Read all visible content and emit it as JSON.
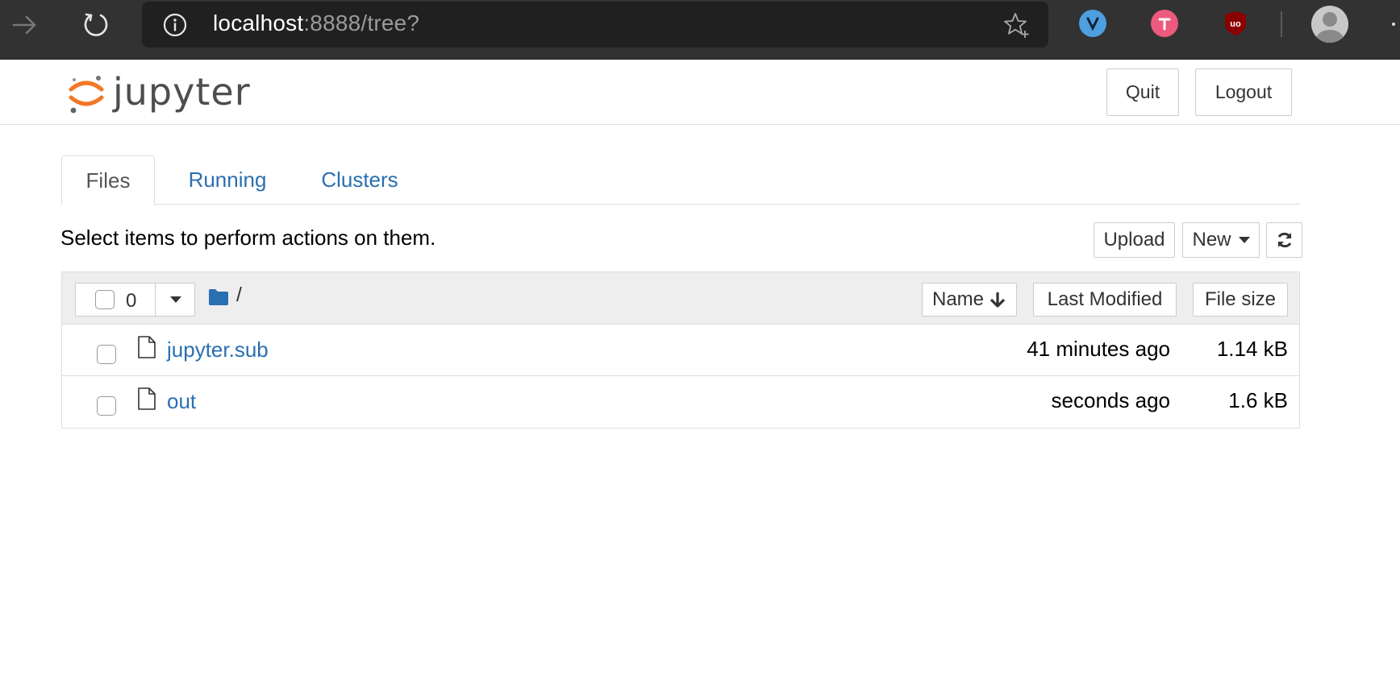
{
  "browser": {
    "url_host": "localhost",
    "url_rest": ":8888/tree?"
  },
  "header": {
    "logo_text": "jupyter",
    "quit_label": "Quit",
    "logout_label": "Logout"
  },
  "tabs": [
    {
      "label": "Files",
      "active": true
    },
    {
      "label": "Running",
      "active": false
    },
    {
      "label": "Clusters",
      "active": false
    }
  ],
  "toolbar": {
    "hint": "Select items to perform actions on them.",
    "upload_label": "Upload",
    "new_label": "New"
  },
  "list": {
    "selected_count": "0",
    "breadcrumb": "/",
    "sort_name_label": "Name",
    "sort_modified_label": "Last Modified",
    "sort_size_label": "File size",
    "files": [
      {
        "name": "jupyter.sub",
        "modified": "41 minutes ago",
        "size": "1.14 kB"
      },
      {
        "name": "out",
        "modified": "seconds ago",
        "size": "1.6 kB"
      }
    ]
  },
  "colors": {
    "link": "#2a6fb0",
    "jupyter_orange": "#f37726",
    "browser_bar": "#323232"
  },
  "icons": [
    "forward-arrow-icon",
    "reload-icon",
    "info-icon",
    "star-add-icon",
    "vivaldi-extension-icon",
    "todoist-extension-icon",
    "ublock-extension-icon",
    "profile-avatar-icon",
    "folder-icon",
    "file-icon",
    "arrow-down-icon",
    "refresh-icon",
    "caret-down-icon"
  ]
}
